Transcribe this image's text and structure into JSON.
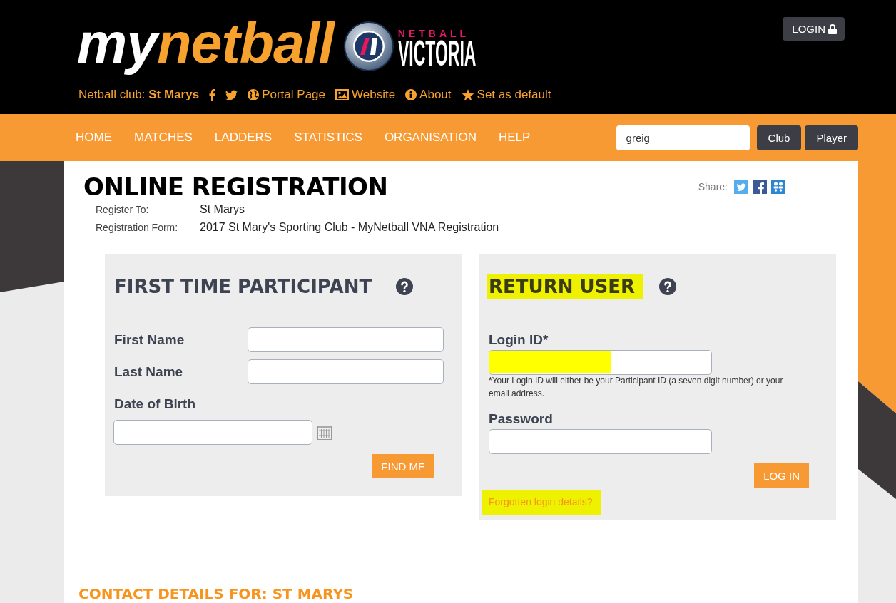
{
  "header": {
    "logo": {
      "part_1": "my",
      "part_2": "netball"
    },
    "partner_logo": {
      "line_1": "NETBALL",
      "line_2": "VICTORIA"
    },
    "club": "Netball club: **St Marys**",
    "club_links": [
      {
        "kind": "facebook"
      },
      {
        "kind": "twitter"
      },
      {
        "kind": "globe",
        "label": "Portal Page"
      },
      {
        "kind": "picture",
        "label": "Website"
      },
      {
        "kind": "info",
        "label": "About"
      },
      {
        "kind": "star",
        "label": "Set as default"
      }
    ],
    "login_button": "LOGIN"
  },
  "nav": {
    "items": [
      "HOME",
      "MATCHES",
      "LADDERS",
      "STATISTICS",
      "ORGANISATION",
      "HELP"
    ],
    "search": {
      "value": "greig"
    },
    "buttons": [
      "Club",
      "Player"
    ]
  },
  "page": {
    "title": "ONLINE REGISTRATION",
    "share": {
      "label": "Share:",
      "icons": [
        {
          "kind": "twitter"
        },
        {
          "kind": "facebook"
        },
        {
          "kind": "people"
        }
      ]
    },
    "details": [
      {
        "label": "Register To:",
        "value": "St Marys"
      },
      {
        "label": "Registration Form:",
        "value": "2017 St Mary's Sporting Club - MyNetball VNA Registration"
      }
    ],
    "panels": [
      {
        "title": "FIRST TIME PARTICIPANT",
        "highlighted": false,
        "fields": [
          {
            "kind": "inline",
            "label": "First Name"
          },
          {
            "kind": "inline",
            "label": "Last Name"
          },
          {
            "kind": "date",
            "label": "Date of Birth"
          }
        ],
        "button": "FIND ME"
      },
      {
        "title": "RETURN USER",
        "highlighted": true,
        "fields": [
          {
            "kind": "stacked",
            "label": "Login ID*",
            "highlighted": true,
            "note": "*Your Login ID will either be your Participant ID (a seven digit number) or your email address."
          },
          {
            "kind": "stacked",
            "label": "Password",
            "highlighted": false
          }
        ],
        "button": "LOG IN",
        "link": {
          "label": "Forgotten login details?",
          "highlighted": true
        }
      }
    ],
    "contact_heading": "CONTACT DETAILS FOR: ST MARYS"
  }
}
